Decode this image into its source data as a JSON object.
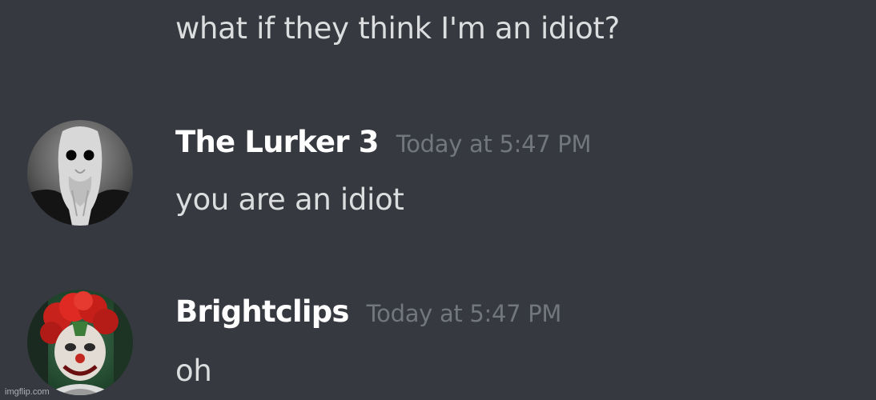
{
  "messages": {
    "prior": {
      "text": "what if they think I'm an idiot?"
    },
    "lurker": {
      "username": "The Lurker 3",
      "timestamp": "Today at 5:47 PM",
      "text": "you are an idiot"
    },
    "brightclips": {
      "username": "Brightclips",
      "timestamp": "Today at 5:47 PM",
      "text": "oh"
    }
  },
  "watermark": "imgflip.com",
  "colors": {
    "background": "#36393f",
    "message_text": "#dcddde",
    "username": "#ffffff",
    "timestamp": "#72767d"
  }
}
